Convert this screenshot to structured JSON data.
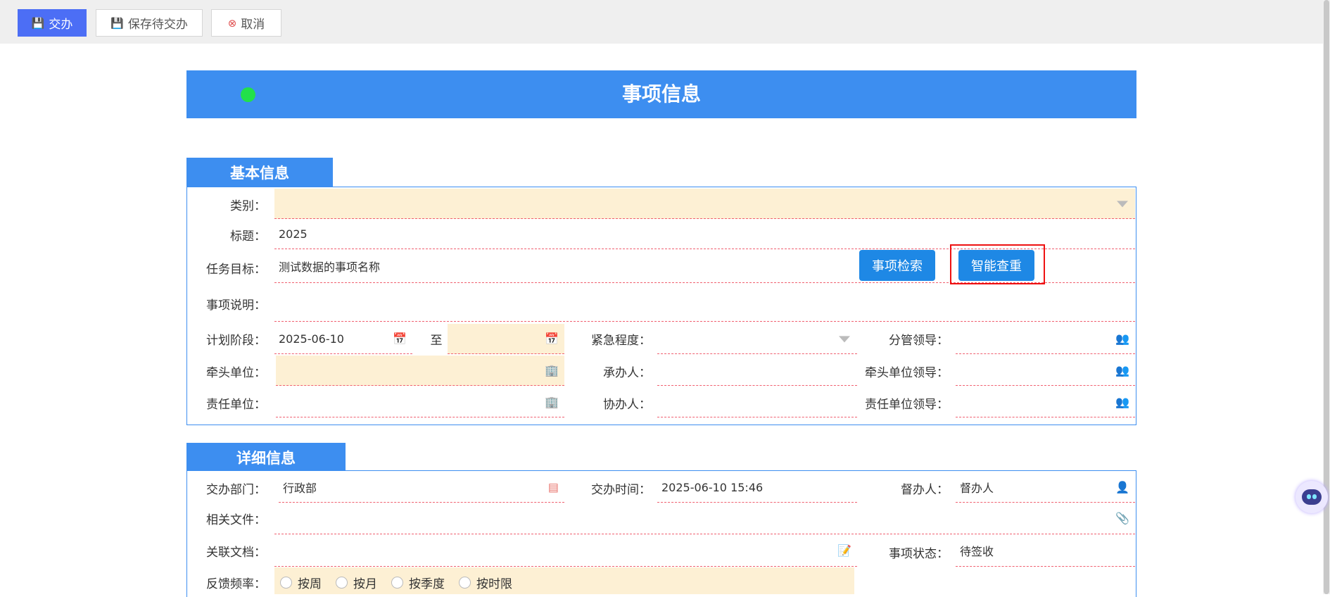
{
  "toolbar": {
    "submit_label": "交办",
    "save_label": "保存待交办",
    "cancel_label": "取消"
  },
  "banner": {
    "title": "事项信息"
  },
  "basic": {
    "section_title": "基本信息",
    "category_label": "类别：",
    "category_value": "",
    "title_label": "标题：",
    "title_value": "2025",
    "goal_label": "任务目标：",
    "goal_value": "测试数据的事项名称",
    "search_button": "事项检索",
    "dedupe_button": "智能查重",
    "desc_label": "事项说明：",
    "desc_value": "",
    "plan_label": "计划阶段：",
    "plan_start": "2025-06-10",
    "plan_to": "至",
    "plan_end": "",
    "urgency_label": "紧急程度：",
    "urgency_value": "",
    "leader_label": "分管领导：",
    "leader_value": "",
    "lead_unit_label": "牵头单位：",
    "lead_unit_value": "",
    "handler_label": "承办人：",
    "handler_value": "",
    "lead_unit_leader_label": "牵头单位领导：",
    "lead_unit_leader_value": "",
    "resp_unit_label": "责任单位：",
    "resp_unit_value": "",
    "assistant_label": "协办人：",
    "assistant_value": "",
    "resp_unit_leader_label": "责任单位领导：",
    "resp_unit_leader_value": ""
  },
  "detail": {
    "section_title": "详细信息",
    "dept_label": "交办部门：",
    "dept_value": "行政部",
    "time_label": "交办时间：",
    "time_value": "2025-06-10 15:46",
    "supervisor_label": "督办人：",
    "supervisor_value": "督办人",
    "files_label": "相关文件：",
    "docs_label": "关联文档：",
    "status_label": "事项状态：",
    "status_value": "待签收",
    "freq_label": "反馈频率：",
    "freq_options": [
      "按周",
      "按月",
      "按季度",
      "按时限"
    ]
  }
}
